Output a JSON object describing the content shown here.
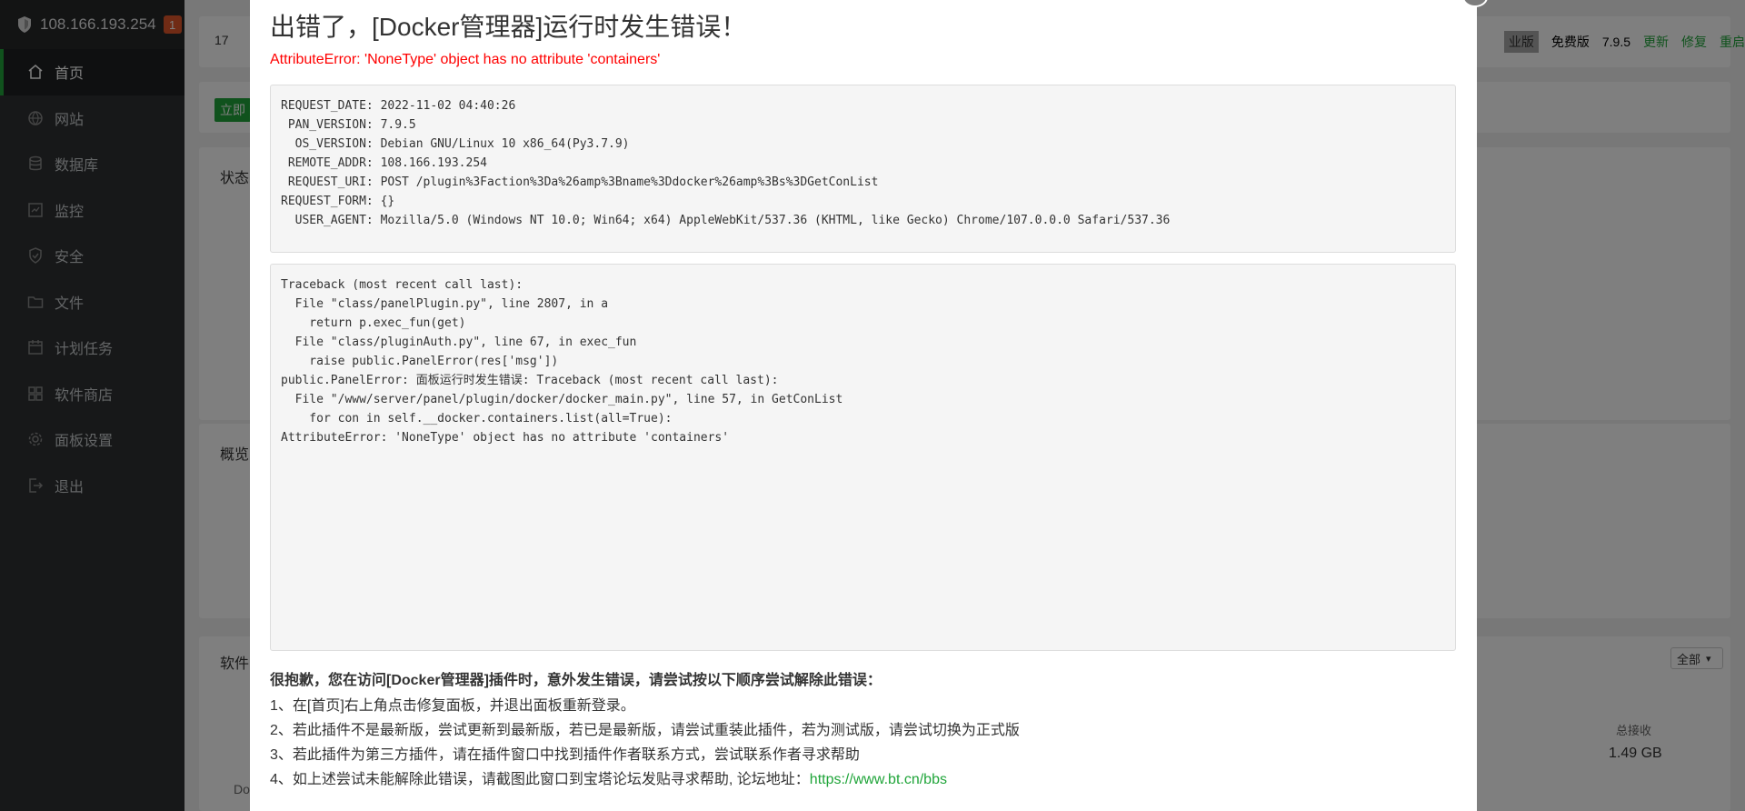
{
  "sidebar": {
    "server_ip": "108.166.193.254",
    "notification_count": "1",
    "items": [
      {
        "label": "首页",
        "icon": "home-icon"
      },
      {
        "label": "网站",
        "icon": "globe-icon"
      },
      {
        "label": "数据库",
        "icon": "database-icon"
      },
      {
        "label": "监控",
        "icon": "monitor-icon"
      },
      {
        "label": "安全",
        "icon": "shield-check-icon"
      },
      {
        "label": "文件",
        "icon": "folder-icon"
      },
      {
        "label": "计划任务",
        "icon": "calendar-icon"
      },
      {
        "label": "软件商店",
        "icon": "grid-icon"
      },
      {
        "label": "面板设置",
        "icon": "gear-icon"
      },
      {
        "label": "退出",
        "icon": "logout-icon"
      }
    ]
  },
  "background": {
    "user_prefix": "17",
    "install_button": "立即",
    "status_title": "状态",
    "overview_title": "概览",
    "software_title": "软件",
    "footer_partial": "Do",
    "filter_all": "全部",
    "total_recv_label": "总接收",
    "total_recv_value": "1.49 GB",
    "topbar": {
      "pro_label": "业版",
      "free_label": "免费版",
      "version": "7.9.5",
      "update": "更新",
      "repair": "修复",
      "restart": "重启"
    }
  },
  "modal": {
    "title": "出错了，[Docker管理器]运行时发生错误！",
    "error_line": "AttributeError: 'NoneType' object has no attribute 'containers'",
    "info_block": "REQUEST_DATE: 2022-11-02 04:40:26\n PAN_VERSION: 7.9.5\n  OS_VERSION: Debian GNU/Linux 10 x86_64(Py3.7.9)\n REMOTE_ADDR: 108.166.193.254\n REQUEST_URI: POST /plugin%3Faction%3Da%26amp%3Bname%3Ddocker%26amp%3Bs%3DGetConList\nREQUEST_FORM: {}\n  USER_AGENT: Mozilla/5.0 (Windows NT 10.0; Win64; x64) AppleWebKit/537.36 (KHTML, like Gecko) Chrome/107.0.0.0 Safari/537.36",
    "traceback_block": "Traceback (most recent call last):\n  File \"class/panelPlugin.py\", line 2807, in a\n    return p.exec_fun(get)\n  File \"class/pluginAuth.py\", line 67, in exec_fun\n    raise public.PanelError(res['msg'])\npublic.PanelError: 面板运行时发生错误: Traceback (most recent call last):\n  File \"/www/server/panel/plugin/docker/docker_main.py\", line 57, in GetConList\n    for con in self.__docker.containers.list(all=True):\nAttributeError: 'NoneType' object has no attribute 'containers'",
    "help_heading": "很抱歉，您在访问[Docker管理器]插件时，意外发生错误，请尝试按以下顺序尝试解除此错误：",
    "help_lines": [
      "1、在[首页]右上角点击修复面板，并退出面板重新登录。",
      "2、若此插件不是最新版，尝试更新到最新版，若已是最新版，请尝试重装此插件，若为测试版，请尝试切换为正式版",
      "3、若此插件为第三方插件，请在插件窗口中找到插件作者联系方式，尝试联系作者寻求帮助"
    ],
    "help_line4_prefix": "4、如上述尝试未能解除此错误，请截图此窗口到宝塔论坛发贴寻求帮助, 论坛地址：",
    "forum_url": "https://www.bt.cn/bbs"
  },
  "colors": {
    "accent_green": "#20a53a",
    "error_red": "#ff0000",
    "badge_orange": "#e0572b"
  }
}
